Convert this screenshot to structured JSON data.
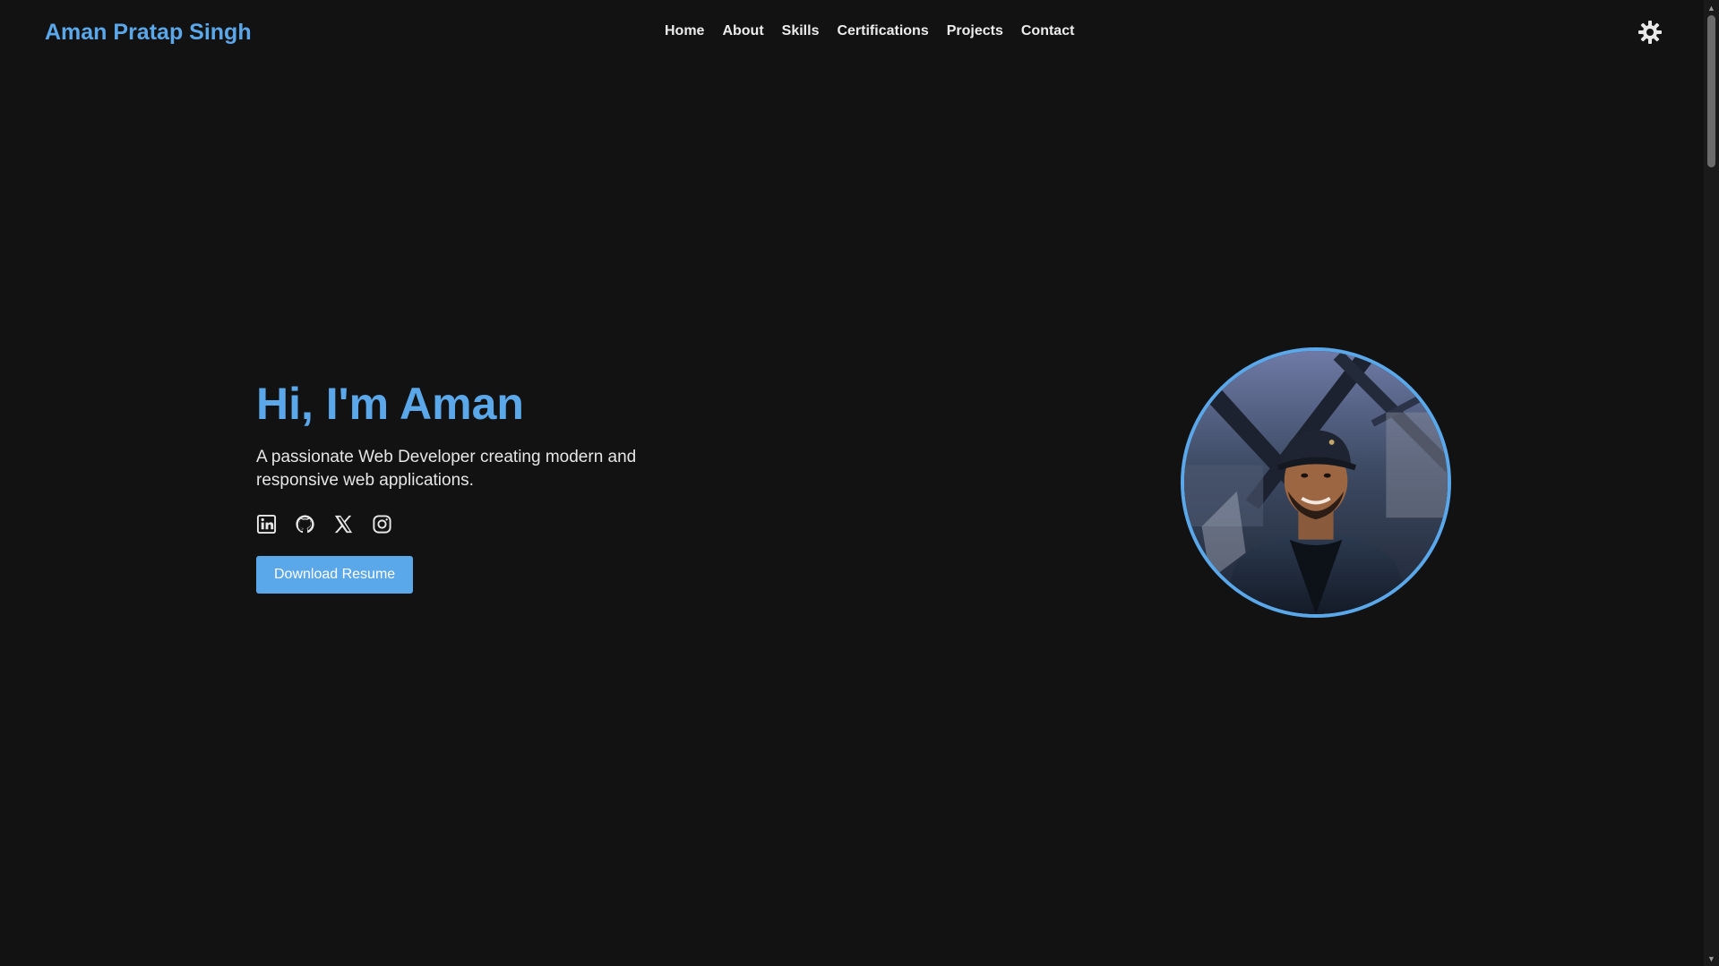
{
  "header": {
    "brand": "Aman Pratap Singh",
    "nav": [
      {
        "label": "Home"
      },
      {
        "label": "About"
      },
      {
        "label": "Skills"
      },
      {
        "label": "Certifications"
      },
      {
        "label": "Projects"
      },
      {
        "label": "Contact"
      }
    ],
    "theme_toggle_icon": "sun-gear-icon"
  },
  "hero": {
    "title": "Hi, I'm Aman",
    "subtitle": "A passionate Web Developer creating modern and responsive web applications.",
    "socials": [
      {
        "icon": "linkedin-icon"
      },
      {
        "icon": "github-icon"
      },
      {
        "icon": "x-twitter-icon"
      },
      {
        "icon": "instagram-icon"
      }
    ],
    "button_label": "Download Resume"
  },
  "colors": {
    "accent": "#5aa7ea",
    "background": "#121213",
    "text": "#e8e8e8"
  }
}
